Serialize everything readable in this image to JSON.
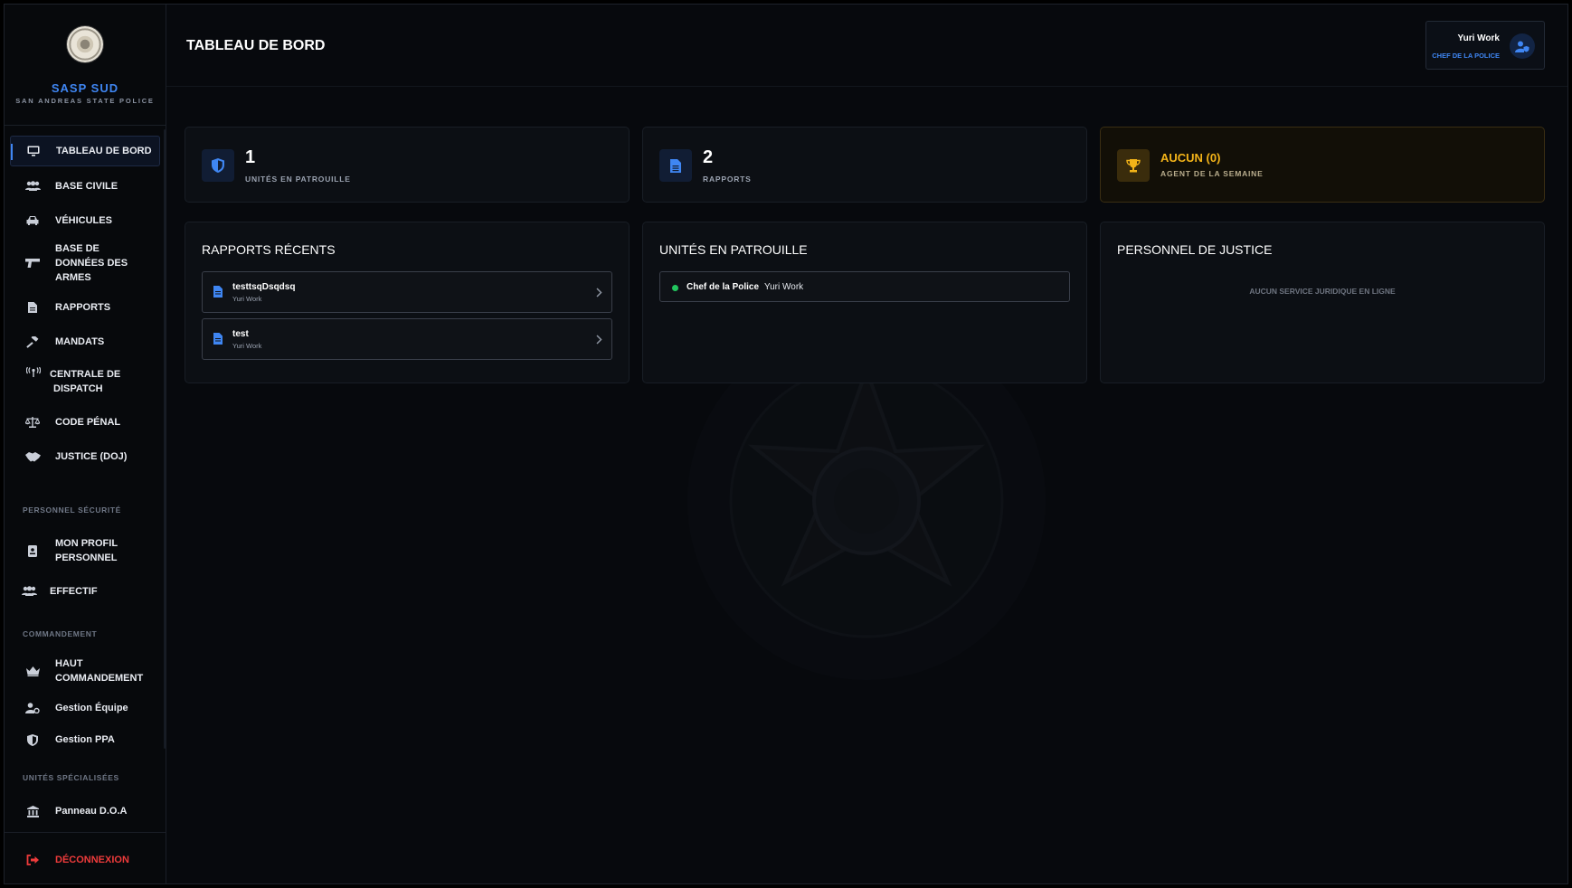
{
  "brand": {
    "name": "SASP SUD",
    "subtitle": "SAN ANDREAS STATE POLICE"
  },
  "nav": {
    "items": [
      {
        "label": "TABLEAU DE BORD",
        "icon": "monitor-icon",
        "active": true
      },
      {
        "label": "BASE CIVILE",
        "icon": "users-icon"
      },
      {
        "label": "VÉHICULES",
        "icon": "car-icon"
      },
      {
        "label": "BASE DE DONNÉES DES ARMES",
        "icon": "gun-icon"
      },
      {
        "label": "RAPPORTS",
        "icon": "file-icon"
      },
      {
        "label": "MANDATS",
        "icon": "gavel-icon"
      },
      {
        "label": "CENTRALE DE DISPATCH",
        "icon": "tower-icon"
      },
      {
        "label": "CODE PÉNAL",
        "icon": "scale-icon"
      },
      {
        "label": "JUSTICE (DOJ)",
        "icon": "handshake-icon"
      }
    ],
    "section_security": "PERSONNEL SÉCURITÉ",
    "security_items": [
      {
        "label": "MON PROFIL PERSONNEL",
        "icon": "id-badge-icon"
      },
      {
        "label": "EFFECTIF",
        "icon": "users-group-icon"
      }
    ],
    "section_command": "COMMANDEMENT",
    "command_items": [
      {
        "label": "HAUT COMMANDEMENT",
        "icon": "crown-icon"
      },
      {
        "label": "Gestion Équipe",
        "icon": "user-gear-icon"
      },
      {
        "label": "Gestion PPA",
        "icon": "shield-icon"
      }
    ],
    "section_special": "UNITÉS SPÉCIALISÉES",
    "special_items": [
      {
        "label": "Panneau D.O.A",
        "icon": "building-icon"
      }
    ],
    "logout": "DÉCONNEXION"
  },
  "header": {
    "title": "TABLEAU DE BORD"
  },
  "user": {
    "name": "Yuri Work",
    "role": "CHEF DE LA POLICE"
  },
  "stats": {
    "patrol": {
      "value": "1",
      "label": "UNITÉS EN PATROUILLE"
    },
    "reports": {
      "value": "2",
      "label": "RAPPORTS"
    },
    "agent": {
      "value": "AUCUN (0)",
      "label": "AGENT DE LA SEMAINE"
    }
  },
  "recent_reports": {
    "title": "RAPPORTS RÉCENTS",
    "items": [
      {
        "title": "testtsqDsqdsq",
        "author": "Yuri Work"
      },
      {
        "title": "test",
        "author": "Yuri Work"
      }
    ]
  },
  "patrol_units": {
    "title": "UNITÉS EN PATROUILLE",
    "items": [
      {
        "rank": "Chef de la Police",
        "name": "Yuri Work"
      }
    ]
  },
  "justice": {
    "title": "PERSONNEL DE JUSTICE",
    "empty": "AUCUN SERVICE JURIDIQUE EN LIGNE"
  },
  "colors": {
    "accent": "#3f86f3",
    "gold": "#f4b419",
    "danger": "#ee3b3b",
    "online": "#22c55e"
  }
}
